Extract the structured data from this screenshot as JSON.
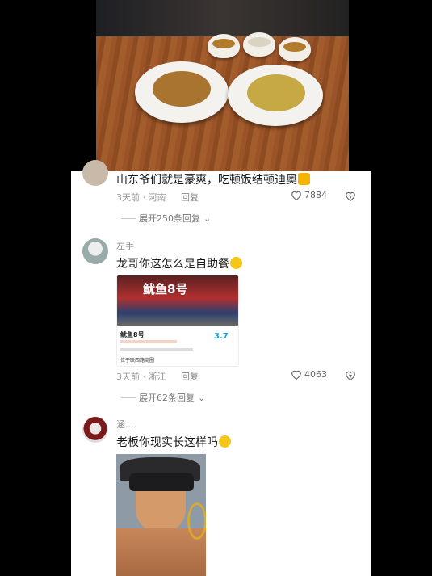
{
  "comments": [
    {
      "text": "山东爷们就是豪爽，吃顿饭结顿迪奥",
      "emoji": "thumbs-up",
      "time": "3天前",
      "location": "河南",
      "reply": "回复",
      "likes": "7884",
      "expand": "展开250条回复"
    },
    {
      "nickname": "左手",
      "text": "龙哥你这怎么是自助餐",
      "emoji": "laughing-face",
      "time": "3天前",
      "location": "浙江",
      "reply": "回复",
      "likes": "4063",
      "expand": "展开62条回复",
      "screenshot": {
        "shop_sign": "鱿鱼8号",
        "shop_name": "鱿鱼8号",
        "rating": "3.7",
        "address": "位于联西路商圈"
      }
    },
    {
      "nickname": "涵....",
      "text": "老板你现实长这样吗",
      "emoji": "laughing-face"
    }
  ],
  "colors": {
    "text": "#161616",
    "meta": "#9a9a9a",
    "rating": "#1aa0d8",
    "card": "#ffffff"
  }
}
